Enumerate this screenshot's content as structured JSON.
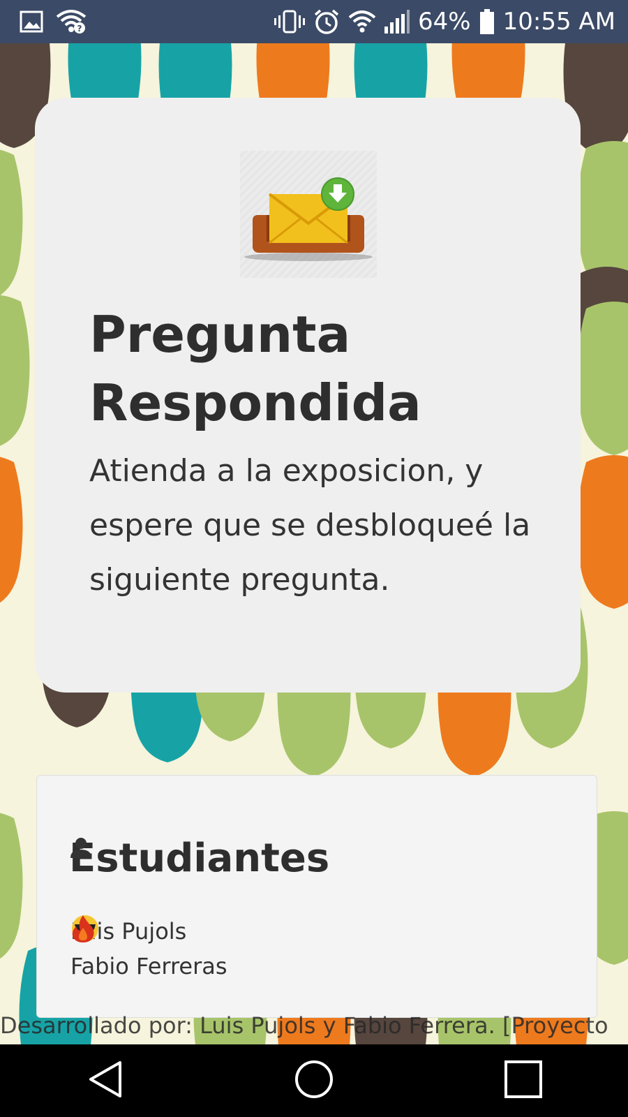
{
  "status_bar": {
    "battery": "64%",
    "time": "10:55 AM",
    "icons": [
      "image-icon",
      "wifi-question-icon",
      "vibrate-icon",
      "alarm-icon",
      "wifi-icon",
      "signal-icon",
      "battery-icon"
    ]
  },
  "main_card": {
    "icon": "mail-download-icon",
    "title_line1": "Pregunta",
    "title_line2": "Respondida",
    "message": "Atienda a la exposicion, y espere que se desbloqueé la siguiente pregunta."
  },
  "students_card": {
    "title": "Estudiantes",
    "icon": "user-icon",
    "students": [
      {
        "name": "Luis Pujols",
        "emoji": "sunglasses-emoji"
      },
      {
        "name": "Fabio Ferreras",
        "emoji": "fire-emoji"
      }
    ]
  },
  "footer": {
    "text": "Desarrollado por: Luis Pujols y Fabio Ferrera. [Proyecto"
  },
  "nav_bar": {
    "buttons": [
      "back-icon",
      "home-icon",
      "recents-icon"
    ]
  },
  "colors": {
    "status_bar": "#3b4a66",
    "wallpaper_bg": "#f6f4dc",
    "teal": "#17a3a6",
    "green": "#a8c46a",
    "orange": "#ee7a1e",
    "brown": "#56463e"
  }
}
